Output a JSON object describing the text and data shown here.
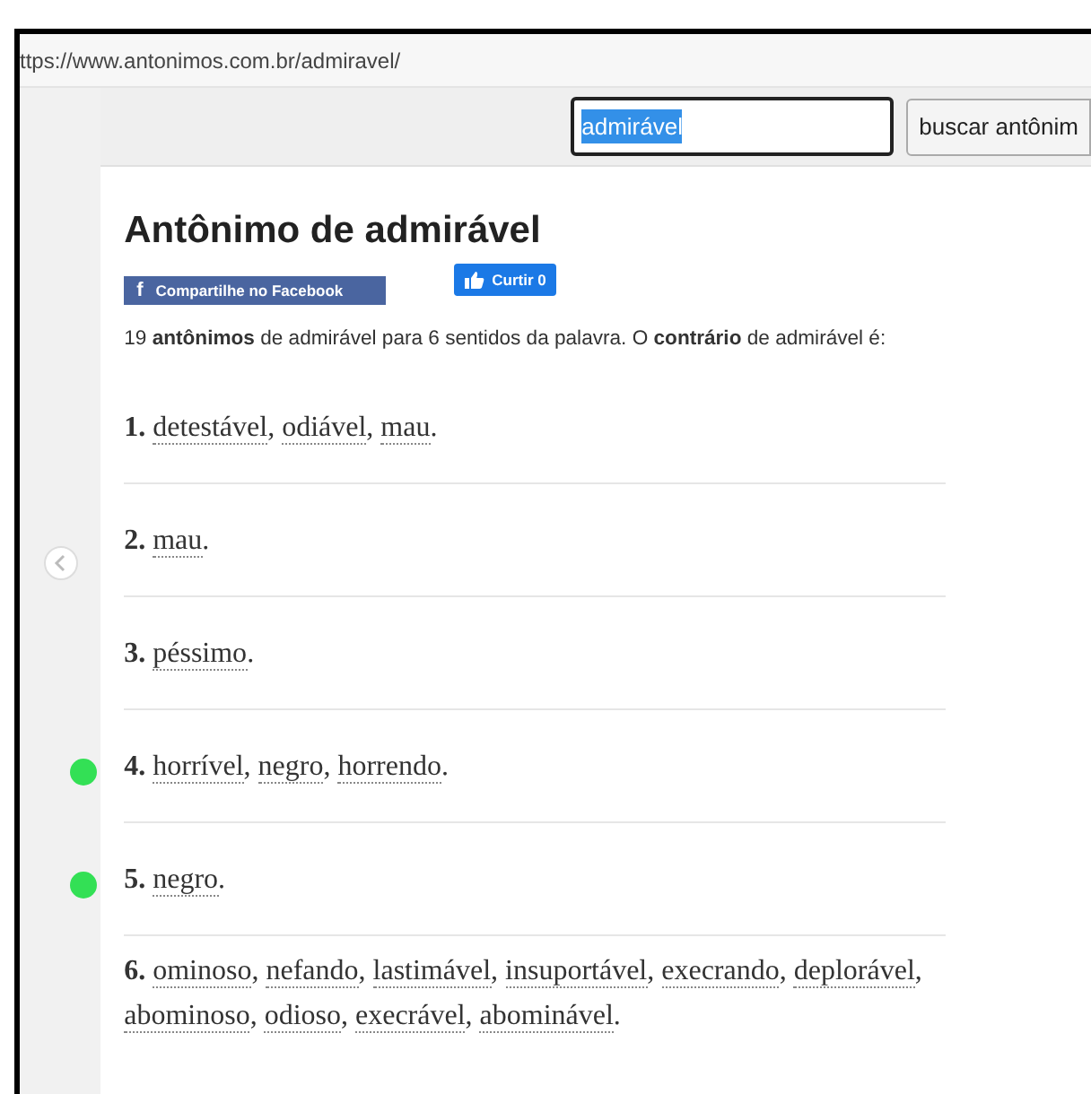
{
  "address_bar": {
    "url": "ttps://www.antonimos.com.br/admiravel/"
  },
  "search": {
    "value": "admirável",
    "text_selected": true,
    "button": "buscar antônim"
  },
  "title": "Antônimo de admirável",
  "share_button": {
    "icon": "f",
    "label": "Compartilhe no Facebook"
  },
  "like_button": {
    "label": "Curtir 0"
  },
  "intro": "19 **antônimos** de admirável para 6 sentidos da palavra. O **contrário** de admirável é:",
  "senses": [
    {
      "number": "1.",
      "marked": false,
      "words": [
        {
          "text": "detestável",
          "sep": ","
        },
        {
          "text": "odiável",
          "sep": ","
        },
        {
          "text": "mau",
          "sep": "."
        }
      ]
    },
    {
      "number": "2.",
      "marked": false,
      "words": [
        {
          "text": "mau",
          "sep": "."
        }
      ]
    },
    {
      "number": "3.",
      "marked": false,
      "words": [
        {
          "text": "péssimo",
          "sep": "."
        }
      ]
    },
    {
      "number": "4.",
      "marked": true,
      "words": [
        {
          "text": "horrível",
          "sep": ","
        },
        {
          "text": "negro",
          "sep": ","
        },
        {
          "text": "horrendo",
          "sep": "."
        }
      ]
    },
    {
      "number": "5.",
      "marked": true,
      "words": [
        {
          "text": "negro",
          "sep": "."
        }
      ]
    },
    {
      "number": "6.",
      "marked": false,
      "words": [
        {
          "text": "ominoso",
          "sep": ","
        },
        {
          "text": "nefando",
          "sep": ","
        },
        {
          "text": "lastimável",
          "sep": ","
        },
        {
          "text": "insuportável",
          "sep": ","
        },
        {
          "text": "execrando",
          "sep": ","
        },
        {
          "text": "deplorável",
          "sep": ","
        },
        {
          "text": "abominoso",
          "sep": ","
        },
        {
          "text": "odioso",
          "sep": ","
        },
        {
          "text": "execrável",
          "sep": ","
        },
        {
          "text": "abominável",
          "sep": "."
        }
      ]
    }
  ]
}
